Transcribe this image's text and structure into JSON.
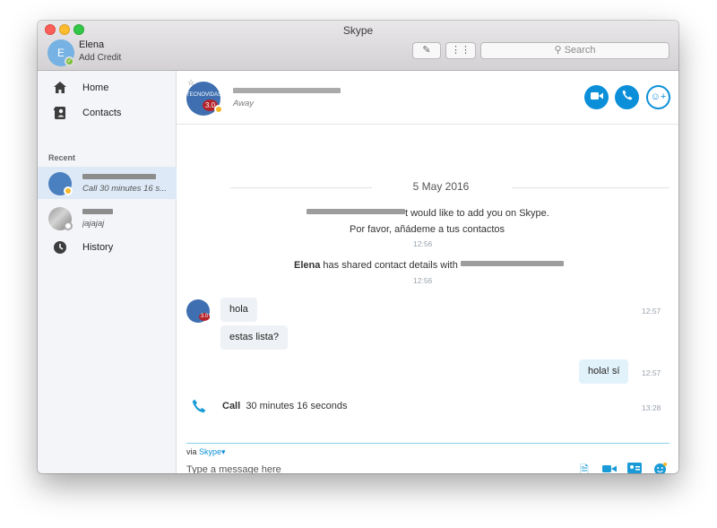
{
  "window": {
    "title": "Skype"
  },
  "profile": {
    "initial": "E",
    "name": "Elena",
    "credit_link": "Add Credit"
  },
  "toolbar": {
    "search_placeholder": "Search"
  },
  "sidebar": {
    "nav": [
      {
        "label": "Home",
        "icon": "home-icon"
      },
      {
        "label": "Contacts",
        "icon": "contacts-icon"
      }
    ],
    "recent_label": "Recent",
    "recent": [
      {
        "subtitle": "Call 30 minutes 16 s...",
        "status": "away"
      },
      {
        "subtitle": "jajajaj",
        "status": "offline"
      }
    ],
    "history_label": "History"
  },
  "conversation": {
    "contact_status": "Away",
    "avatar_brand": "TECNOVIDAS",
    "avatar_badge": "3.0",
    "date_separator": "5 May 2016",
    "system_messages": [
      {
        "text": "t would like to add you on Skype.",
        "text2": "Por favor, añádeme a tus contactos",
        "time": "12:56"
      },
      {
        "sender": "Elena",
        "text": " has shared contact details with ",
        "time": "12:56"
      }
    ],
    "messages": [
      {
        "text": "hola",
        "direction": "in",
        "time": "12:57"
      },
      {
        "text": "estas lista?",
        "direction": "in"
      },
      {
        "text": "hola! sí",
        "direction": "out",
        "time": "12:57"
      }
    ],
    "call_event": {
      "label": "Call",
      "duration": "30 minutes 16 seconds",
      "time": "13:28"
    }
  },
  "composer": {
    "via_label": "via",
    "via_service": "Skype",
    "placeholder": "Type a message here"
  },
  "colors": {
    "accent": "#0b8fd9",
    "away": "#f6b829",
    "online": "#7cbf3b"
  }
}
